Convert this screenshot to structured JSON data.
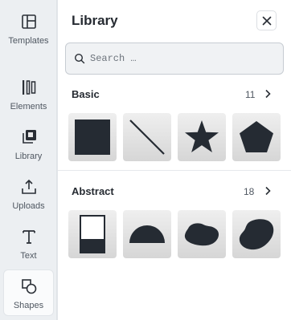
{
  "sidebar": {
    "items": [
      {
        "label": "Templates",
        "icon": "templates-icon"
      },
      {
        "label": "Elements",
        "icon": "elements-icon"
      },
      {
        "label": "Library",
        "icon": "library-icon"
      },
      {
        "label": "Uploads",
        "icon": "upload-icon"
      },
      {
        "label": "Text",
        "icon": "text-icon"
      },
      {
        "label": "Shapes",
        "icon": "shapes-icon",
        "active": true
      }
    ]
  },
  "panel": {
    "title": "Library",
    "close_icon": "close-icon",
    "search": {
      "placeholder": "Search …",
      "value": ""
    },
    "sections": [
      {
        "title": "Basic",
        "count": "11",
        "items": [
          "square-shape",
          "line-shape",
          "star-shape",
          "pentagon-shape"
        ]
      },
      {
        "title": "Abstract",
        "count": "18",
        "items": [
          "partial-rect-shape",
          "half-circle-shape",
          "blob-shape",
          "blob-shape-2"
        ]
      }
    ]
  },
  "colors": {
    "accent": "#252b33",
    "rail": "#eceff2",
    "tile": "#dedede"
  }
}
